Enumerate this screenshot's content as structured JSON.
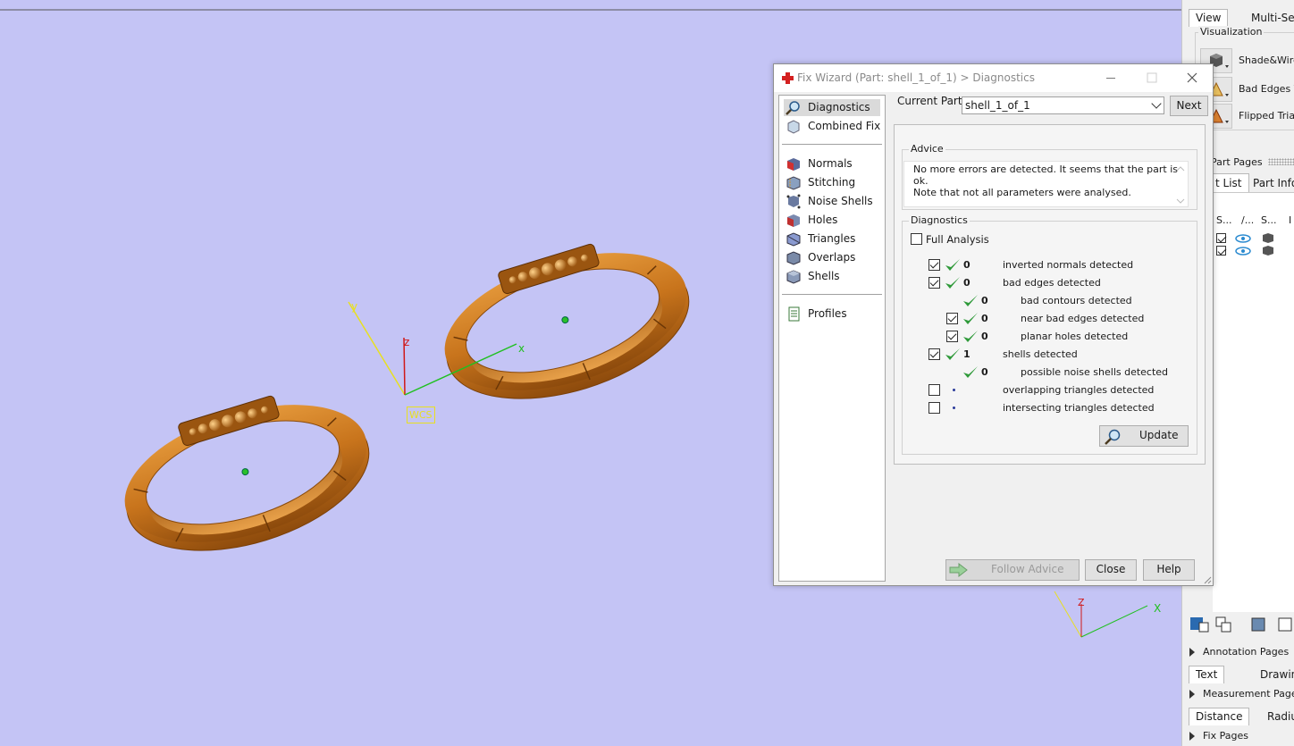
{
  "viewport": {
    "wcs_label": "WCS",
    "axes": {
      "x": "x",
      "y": "y",
      "z": "z"
    },
    "corner_axes": {
      "x": "X",
      "z": "Z"
    }
  },
  "right_panel": {
    "tabs": [
      {
        "label": "View",
        "active": true
      },
      {
        "label": "Multi-Secti",
        "active": false
      }
    ],
    "visualization": {
      "title": "Visualization",
      "buttons": [
        {
          "label": "Shade&Wire",
          "icon": "cube-shade-icon"
        },
        {
          "label": "Bad Edges Vis",
          "icon": "bad-edges-icon"
        },
        {
          "label": "Flipped Triang",
          "icon": "flipped-triangles-icon"
        }
      ]
    },
    "part_pages": {
      "title": "Part Pages",
      "tabs": [
        {
          "label": "t List",
          "active": true
        },
        {
          "label": "Part Info",
          "active": false
        }
      ],
      "columns": [
        "S...",
        "/...",
        "S...",
        "I"
      ]
    },
    "sections": [
      {
        "label": "Annotation Pages",
        "tabs": [
          "Text",
          "Drawing"
        ]
      },
      {
        "label": "Measurement Pages",
        "tabs": [
          "Distance",
          "Radius"
        ]
      },
      {
        "label": "Fix Pages",
        "tabs": []
      }
    ]
  },
  "dialog": {
    "title": "Fix Wizard (Part: shell_1_of_1) > Diagnostics",
    "nav": {
      "group1": [
        {
          "label": "Diagnostics",
          "icon": "magnifier-icon",
          "selected": true
        },
        {
          "label": "Combined Fix",
          "icon": "combined-fix-icon",
          "selected": false
        }
      ],
      "group2": [
        {
          "label": "Normals",
          "icon": "normals-icon"
        },
        {
          "label": "Stitching",
          "icon": "stitching-icon"
        },
        {
          "label": "Noise Shells",
          "icon": "noise-shells-icon"
        },
        {
          "label": "Holes",
          "icon": "holes-icon"
        },
        {
          "label": "Triangles",
          "icon": "triangles-icon"
        },
        {
          "label": "Overlaps",
          "icon": "overlaps-icon"
        },
        {
          "label": "Shells",
          "icon": "shells-icon"
        }
      ],
      "group3": [
        {
          "label": "Profiles",
          "icon": "profiles-icon"
        }
      ]
    },
    "current_part_label": "Current Part:",
    "current_part_value": "shell_1_of_1",
    "next_label": "Next",
    "advice": {
      "title": "Advice",
      "text_line1": "No more errors are detected. It seems that the part is ok.",
      "text_line2": "Note that not all parameters were analysed."
    },
    "diagnostics": {
      "title": "Diagnostics",
      "full_analysis_label": "Full Analysis",
      "full_analysis_checked": false,
      "rows": [
        {
          "checked": true,
          "has_checkbox": true,
          "ok": true,
          "count": "0",
          "label": "inverted normals detected",
          "indent": 0
        },
        {
          "checked": true,
          "has_checkbox": true,
          "ok": true,
          "count": "0",
          "label": "bad edges detected",
          "indent": 0
        },
        {
          "checked": false,
          "has_checkbox": false,
          "ok": true,
          "count": "0",
          "label": "bad contours detected",
          "indent": 1
        },
        {
          "checked": true,
          "has_checkbox": true,
          "ok": true,
          "count": "0",
          "label": "near bad edges detected",
          "indent": 1
        },
        {
          "checked": true,
          "has_checkbox": true,
          "ok": true,
          "count": "0",
          "label": "planar holes detected",
          "indent": 1
        },
        {
          "checked": true,
          "has_checkbox": true,
          "ok": true,
          "count": "1",
          "label": "shells detected",
          "indent": 0
        },
        {
          "checked": false,
          "has_checkbox": false,
          "ok": true,
          "count": "0",
          "label": "possible noise shells detected",
          "indent": 1
        },
        {
          "checked": false,
          "has_checkbox": true,
          "ok": false,
          "count": "",
          "label": "overlapping triangles detected",
          "indent": 0
        },
        {
          "checked": false,
          "has_checkbox": true,
          "ok": false,
          "count": "",
          "label": "intersecting triangles detected",
          "indent": 0
        }
      ],
      "update_label": "Update"
    },
    "follow_advice_label": "Follow Advice",
    "close_label": "Close",
    "help_label": "Help"
  },
  "colors": {
    "viewport_bg": "#c4c4f5",
    "ring_body": "#c8741c",
    "check_green": "#2f9a3a",
    "x_axis": "#20c020",
    "y_axis": "#e8e020",
    "z_axis": "#d01818"
  }
}
